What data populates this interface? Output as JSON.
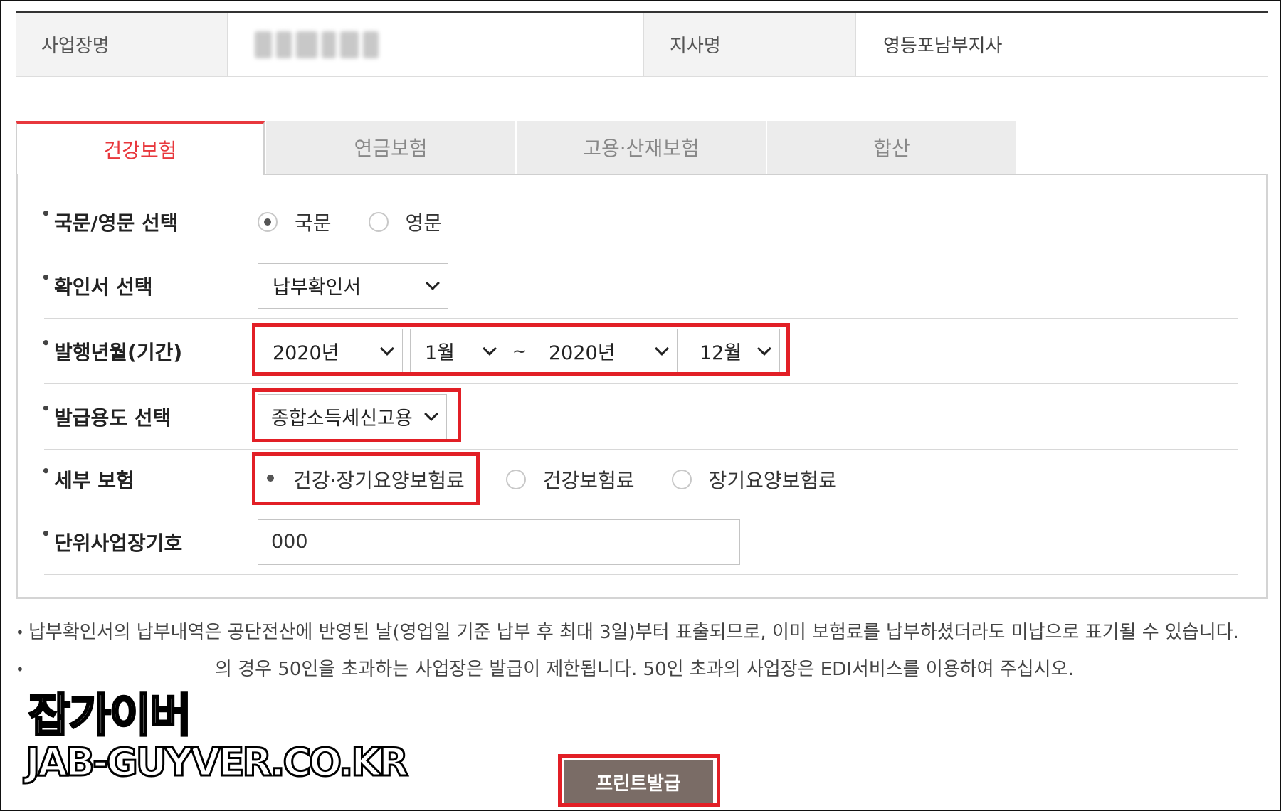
{
  "info": {
    "business_name_label": "사업장명",
    "branch_label": "지사명",
    "branch_value": "영등포남부지사"
  },
  "tabs": [
    {
      "label": "건강보험",
      "active": true
    },
    {
      "label": "연금보험",
      "active": false
    },
    {
      "label": "고용·산재보험",
      "active": false
    },
    {
      "label": "합산",
      "active": false
    }
  ],
  "form": {
    "language": {
      "label": "국문/영문 선택",
      "options": [
        {
          "label": "국문",
          "selected": true
        },
        {
          "label": "영문",
          "selected": false
        }
      ]
    },
    "certificate": {
      "label": "확인서 선택",
      "value": "납부확인서"
    },
    "period": {
      "label": "발행년월(기간)",
      "from_year": "2020년",
      "from_month": "1월",
      "separator": "~",
      "to_year": "2020년",
      "to_month": "12월"
    },
    "purpose": {
      "label": "발급용도 선택",
      "value": "종합소득세신고용"
    },
    "detail_insurance": {
      "label": "세부 보험",
      "options": [
        {
          "label": "건강·장기요양보험료",
          "selected": true
        },
        {
          "label": "건강보험료",
          "selected": false
        },
        {
          "label": "장기요양보험료",
          "selected": false
        }
      ]
    },
    "unit_code": {
      "label": "단위사업장기호",
      "value": "000"
    }
  },
  "notes": [
    "납부확인서의 납부내역은 공단전산에 반영된 날(영업일 기준 납부 후 최대 3일)부터 표출되므로, 이미 보험료를 납부하셨더라도 미납으로 표기될 수 있습니다.",
    "의 경우 50인을 초과하는 사업장은 발급이 제한됩니다. 50인 초과의 사업장은 EDI서비스를 이용하여 주십시오."
  ],
  "watermark": {
    "line1": "잡가이버",
    "line2": "JAB-GUYVER.CO.KR"
  },
  "print_button": "프린트발급",
  "colors": {
    "accent": "#e8383d",
    "highlight": "#e21f26",
    "button": "#7a6c66"
  }
}
